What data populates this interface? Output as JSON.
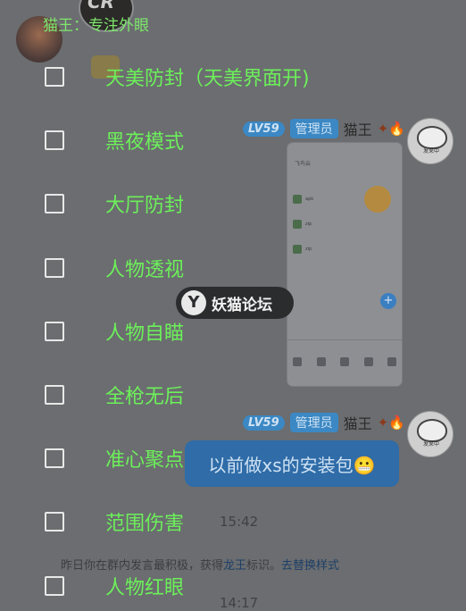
{
  "header": {
    "overlay_title": "猫王：专注外眼"
  },
  "menu": {
    "items": [
      {
        "label": "天美防封（天美界面开)",
        "checked": false
      },
      {
        "label": "黑夜模式",
        "checked": false
      },
      {
        "label": "大厅防封",
        "checked": false
      },
      {
        "label": "人物透视",
        "checked": false
      },
      {
        "label": "人物自瞄",
        "checked": false
      },
      {
        "label": "全枪无后",
        "checked": false
      },
      {
        "label": "准心聚点",
        "checked": false
      },
      {
        "label": "范围伤害",
        "checked": false
      },
      {
        "label": "人物红眼",
        "checked": false
      }
    ]
  },
  "chat": {
    "messages": [
      {
        "level": "LV59",
        "role": "管理员",
        "sender": "猫王"
      },
      {
        "level": "LV59",
        "role": "管理员",
        "sender": "猫王",
        "text": "以前做xs的安装包😬"
      }
    ],
    "timestamps": [
      "15:42",
      "14:17"
    ],
    "system_notice": {
      "prefix": "昨日你在群内发言最积极，获得",
      "title": "龙王",
      "suffix": "标识。",
      "action": "去替换样式"
    }
  },
  "watermark": {
    "text": "妖猫论坛"
  },
  "colors": {
    "menu_text": "#6cf05a",
    "background": "#6b6d70",
    "badge": "#3b88c4",
    "bubble": "#2f6ca8"
  }
}
